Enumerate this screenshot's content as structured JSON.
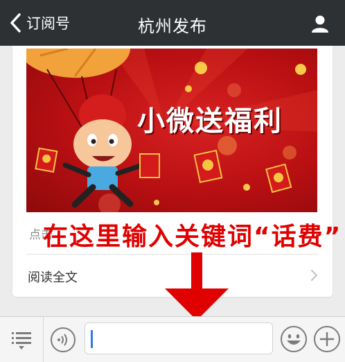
{
  "nav": {
    "back_label": "订阅号",
    "title": "杭州发布",
    "back_icon": "chevron-left-icon",
    "profile_icon": "person-icon"
  },
  "card": {
    "banner_text": "小微送福利",
    "caption": "点击",
    "read_all": "阅读全文"
  },
  "annotation": {
    "text": "在这里输入关键词“话费”",
    "color": "#e00000"
  },
  "inputbar": {
    "text_value": "",
    "menu_icon": "menu-list-icon",
    "voice_icon": "voice-icon",
    "emoji_icon": "emoji-icon",
    "plus_icon": "plus-icon"
  },
  "colors": {
    "navbar": "#2e3134",
    "banner_red": "#c41216",
    "accent_blue": "#2c7be5"
  }
}
